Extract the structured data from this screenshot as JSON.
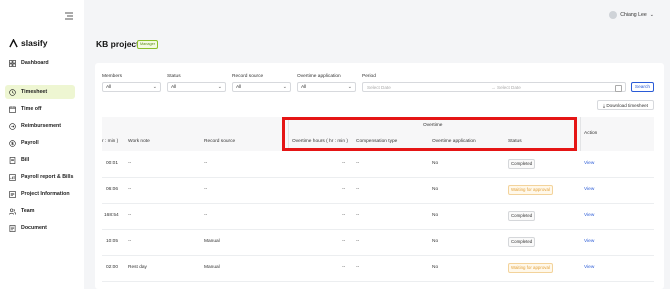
{
  "sidebar": {
    "logo": "slasify",
    "items": [
      {
        "label": "Dashboard",
        "icon": "dashboard-icon"
      },
      {
        "label": "Timesheet",
        "icon": "clock-icon"
      },
      {
        "label": "Time off",
        "icon": "calendar-icon"
      },
      {
        "label": "Reimbursement",
        "icon": "reimbursement-icon"
      },
      {
        "label": "Payroll",
        "icon": "payroll-icon"
      },
      {
        "label": "Bill",
        "icon": "bill-icon"
      },
      {
        "label": "Payroll report & Bills",
        "icon": "report-icon"
      },
      {
        "label": "Project Information",
        "icon": "project-icon"
      },
      {
        "label": "Team",
        "icon": "team-icon"
      },
      {
        "label": "Document",
        "icon": "document-icon"
      }
    ]
  },
  "header": {
    "user": "Chiang Lee"
  },
  "page": {
    "title": "KB project",
    "role": "Manager"
  },
  "filters": {
    "members": {
      "label": "Members",
      "value": "All"
    },
    "status": {
      "label": "Status",
      "value": "All"
    },
    "record_source": {
      "label": "Record source",
      "value": "All"
    },
    "overtime_application": {
      "label": "Overtime application",
      "value": "All"
    },
    "period": {
      "label": "Period",
      "start_placeholder": "Select Date",
      "end_placeholder": "Select Date",
      "separator": "→"
    },
    "search_label": "Search",
    "download_label": "Download timesheet"
  },
  "table": {
    "group_header": "Overtime",
    "columns": {
      "hours": "r : min )",
      "work_note": "Work note",
      "record_source": "Record source",
      "overtime_hours": "Overtime hours ( hr : min )",
      "compensation_type": "Compensation type",
      "overtime_application": "Overtime application",
      "status": "Status",
      "action": "Action"
    },
    "rows": [
      {
        "hours": "00:01",
        "work_note": "--",
        "record_source": "--",
        "overtime_hours": "--",
        "compensation_type": "--",
        "overtime_application": "No",
        "status": "Completed",
        "status_type": "done",
        "action": "View"
      },
      {
        "hours": "06:06",
        "work_note": "--",
        "record_source": "--",
        "overtime_hours": "--",
        "compensation_type": "--",
        "overtime_application": "No",
        "status": "Waiting for approval",
        "status_type": "wait",
        "action": "View"
      },
      {
        "hours": "168:54",
        "work_note": "--",
        "record_source": "--",
        "overtime_hours": "--",
        "compensation_type": "--",
        "overtime_application": "No",
        "status": "Completed",
        "status_type": "done",
        "action": "View"
      },
      {
        "hours": "10:05",
        "work_note": "--",
        "record_source": "Manual",
        "overtime_hours": "--",
        "compensation_type": "--",
        "overtime_application": "No",
        "status": "Completed",
        "status_type": "done",
        "action": "View"
      },
      {
        "hours": "02:00",
        "work_note": "Rest day",
        "record_source": "Manual",
        "overtime_hours": "--",
        "compensation_type": "--",
        "overtime_application": "No",
        "status": "Waiting for approval",
        "status_type": "wait",
        "action": "View"
      }
    ]
  },
  "colors": {
    "accent": "#2a5bd7",
    "active_nav": "#eef6d2",
    "highlight": "#e51515",
    "warning": "#e3a23c"
  }
}
